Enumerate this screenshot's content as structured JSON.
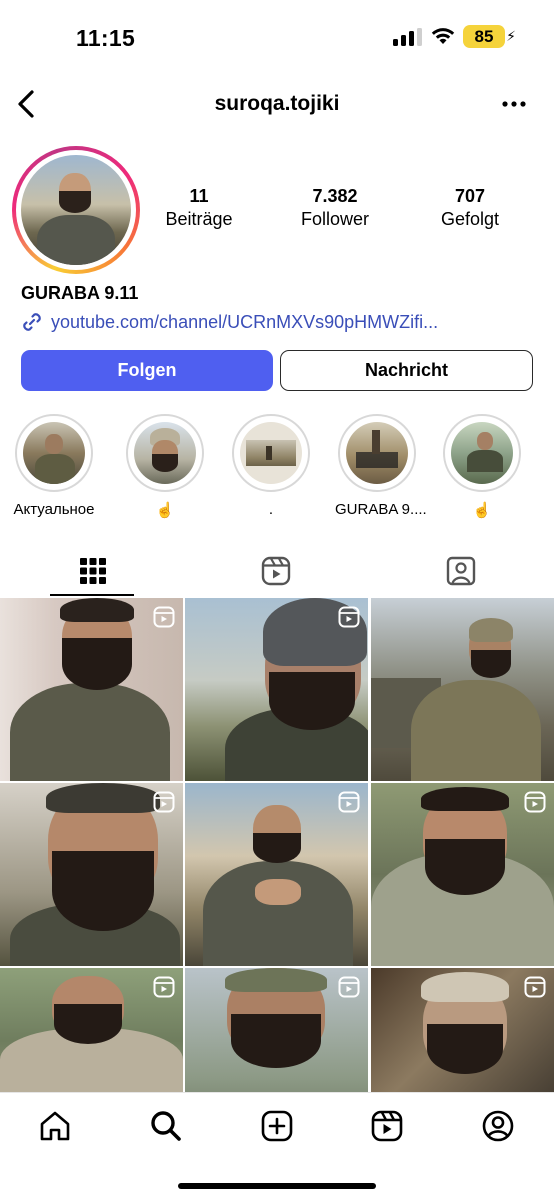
{
  "status_bar": {
    "time": "11:15",
    "battery": "85"
  },
  "header": {
    "username": "suroqa.tojiki"
  },
  "profile": {
    "stats": [
      {
        "value": "11",
        "label": "Beiträge"
      },
      {
        "value": "7.382",
        "label": "Follower"
      },
      {
        "value": "707",
        "label": "Gefolgt"
      }
    ],
    "name": "GURABA 9.11",
    "link": "youtube.com/channel/UCRnMXVs90pHMWZifi..."
  },
  "actions": {
    "follow": "Folgen",
    "message": "Nachricht"
  },
  "highlights": [
    {
      "label": "Актуальное"
    },
    {
      "label": "☝️"
    },
    {
      "label": "."
    },
    {
      "label": "GURABA 9...."
    },
    {
      "label": "☝️"
    }
  ],
  "tabs": [
    {
      "name": "posts-grid",
      "icon": "grid-icon"
    },
    {
      "name": "reels",
      "icon": "reels-icon"
    },
    {
      "name": "tagged",
      "icon": "tagged-user-icon"
    }
  ],
  "bottom_nav": [
    "home-icon",
    "search-icon",
    "create-icon",
    "reels-icon",
    "profile-icon"
  ],
  "colors": {
    "follow_button": "#4f5ff0",
    "link": "#3a4eb8",
    "battery": "#f5d33b"
  }
}
